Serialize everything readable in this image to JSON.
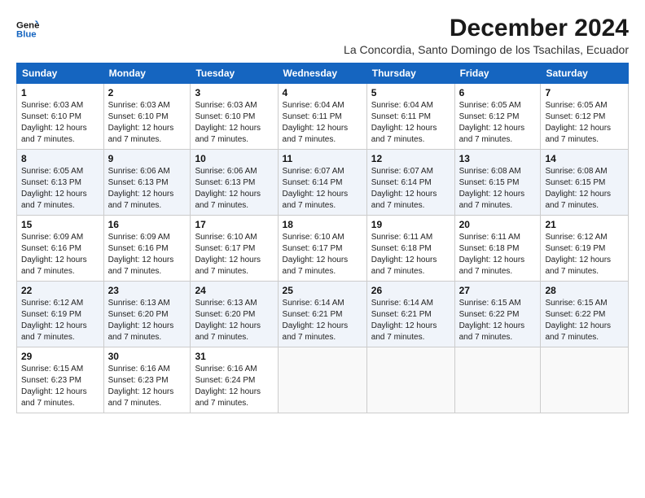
{
  "logo": {
    "line1": "General",
    "line2": "Blue"
  },
  "title": "December 2024",
  "subtitle": "La Concordia, Santo Domingo de los Tsachilas, Ecuador",
  "days_header": [
    "Sunday",
    "Monday",
    "Tuesday",
    "Wednesday",
    "Thursday",
    "Friday",
    "Saturday"
  ],
  "weeks": [
    [
      {
        "day": "1",
        "info": "Sunrise: 6:03 AM\nSunset: 6:10 PM\nDaylight: 12 hours\nand 7 minutes."
      },
      {
        "day": "2",
        "info": "Sunrise: 6:03 AM\nSunset: 6:10 PM\nDaylight: 12 hours\nand 7 minutes."
      },
      {
        "day": "3",
        "info": "Sunrise: 6:03 AM\nSunset: 6:10 PM\nDaylight: 12 hours\nand 7 minutes."
      },
      {
        "day": "4",
        "info": "Sunrise: 6:04 AM\nSunset: 6:11 PM\nDaylight: 12 hours\nand 7 minutes."
      },
      {
        "day": "5",
        "info": "Sunrise: 6:04 AM\nSunset: 6:11 PM\nDaylight: 12 hours\nand 7 minutes."
      },
      {
        "day": "6",
        "info": "Sunrise: 6:05 AM\nSunset: 6:12 PM\nDaylight: 12 hours\nand 7 minutes."
      },
      {
        "day": "7",
        "info": "Sunrise: 6:05 AM\nSunset: 6:12 PM\nDaylight: 12 hours\nand 7 minutes."
      }
    ],
    [
      {
        "day": "8",
        "info": "Sunrise: 6:05 AM\nSunset: 6:13 PM\nDaylight: 12 hours\nand 7 minutes."
      },
      {
        "day": "9",
        "info": "Sunrise: 6:06 AM\nSunset: 6:13 PM\nDaylight: 12 hours\nand 7 minutes."
      },
      {
        "day": "10",
        "info": "Sunrise: 6:06 AM\nSunset: 6:13 PM\nDaylight: 12 hours\nand 7 minutes."
      },
      {
        "day": "11",
        "info": "Sunrise: 6:07 AM\nSunset: 6:14 PM\nDaylight: 12 hours\nand 7 minutes."
      },
      {
        "day": "12",
        "info": "Sunrise: 6:07 AM\nSunset: 6:14 PM\nDaylight: 12 hours\nand 7 minutes."
      },
      {
        "day": "13",
        "info": "Sunrise: 6:08 AM\nSunset: 6:15 PM\nDaylight: 12 hours\nand 7 minutes."
      },
      {
        "day": "14",
        "info": "Sunrise: 6:08 AM\nSunset: 6:15 PM\nDaylight: 12 hours\nand 7 minutes."
      }
    ],
    [
      {
        "day": "15",
        "info": "Sunrise: 6:09 AM\nSunset: 6:16 PM\nDaylight: 12 hours\nand 7 minutes."
      },
      {
        "day": "16",
        "info": "Sunrise: 6:09 AM\nSunset: 6:16 PM\nDaylight: 12 hours\nand 7 minutes."
      },
      {
        "day": "17",
        "info": "Sunrise: 6:10 AM\nSunset: 6:17 PM\nDaylight: 12 hours\nand 7 minutes."
      },
      {
        "day": "18",
        "info": "Sunrise: 6:10 AM\nSunset: 6:17 PM\nDaylight: 12 hours\nand 7 minutes."
      },
      {
        "day": "19",
        "info": "Sunrise: 6:11 AM\nSunset: 6:18 PM\nDaylight: 12 hours\nand 7 minutes."
      },
      {
        "day": "20",
        "info": "Sunrise: 6:11 AM\nSunset: 6:18 PM\nDaylight: 12 hours\nand 7 minutes."
      },
      {
        "day": "21",
        "info": "Sunrise: 6:12 AM\nSunset: 6:19 PM\nDaylight: 12 hours\nand 7 minutes."
      }
    ],
    [
      {
        "day": "22",
        "info": "Sunrise: 6:12 AM\nSunset: 6:19 PM\nDaylight: 12 hours\nand 7 minutes."
      },
      {
        "day": "23",
        "info": "Sunrise: 6:13 AM\nSunset: 6:20 PM\nDaylight: 12 hours\nand 7 minutes."
      },
      {
        "day": "24",
        "info": "Sunrise: 6:13 AM\nSunset: 6:20 PM\nDaylight: 12 hours\nand 7 minutes."
      },
      {
        "day": "25",
        "info": "Sunrise: 6:14 AM\nSunset: 6:21 PM\nDaylight: 12 hours\nand 7 minutes."
      },
      {
        "day": "26",
        "info": "Sunrise: 6:14 AM\nSunset: 6:21 PM\nDaylight: 12 hours\nand 7 minutes."
      },
      {
        "day": "27",
        "info": "Sunrise: 6:15 AM\nSunset: 6:22 PM\nDaylight: 12 hours\nand 7 minutes."
      },
      {
        "day": "28",
        "info": "Sunrise: 6:15 AM\nSunset: 6:22 PM\nDaylight: 12 hours\nand 7 minutes."
      }
    ],
    [
      {
        "day": "29",
        "info": "Sunrise: 6:15 AM\nSunset: 6:23 PM\nDaylight: 12 hours\nand 7 minutes."
      },
      {
        "day": "30",
        "info": "Sunrise: 6:16 AM\nSunset: 6:23 PM\nDaylight: 12 hours\nand 7 minutes."
      },
      {
        "day": "31",
        "info": "Sunrise: 6:16 AM\nSunset: 6:24 PM\nDaylight: 12 hours\nand 7 minutes."
      },
      {
        "day": "",
        "info": ""
      },
      {
        "day": "",
        "info": ""
      },
      {
        "day": "",
        "info": ""
      },
      {
        "day": "",
        "info": ""
      }
    ]
  ]
}
